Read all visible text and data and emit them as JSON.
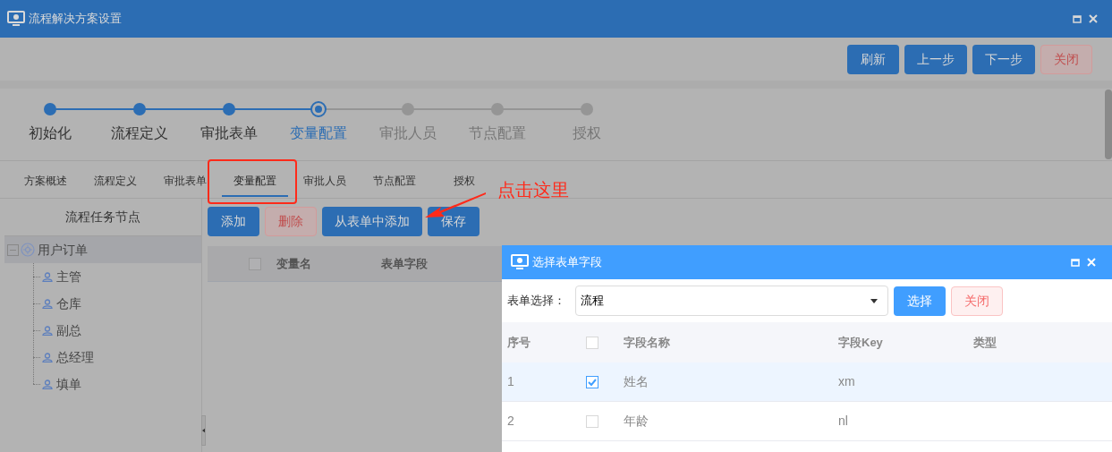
{
  "window": {
    "title": "流程解决方案设置"
  },
  "toolbar": [
    {
      "label": "刷新",
      "kind": "primary"
    },
    {
      "label": "上一步",
      "kind": "primary"
    },
    {
      "label": "下一步",
      "kind": "primary"
    },
    {
      "label": "关闭",
      "kind": "danger"
    }
  ],
  "steps": [
    {
      "label": "初始化",
      "completed": true,
      "current": false
    },
    {
      "label": "流程定义",
      "completed": true,
      "current": false
    },
    {
      "label": "审批表单",
      "completed": true,
      "current": false
    },
    {
      "label": "变量配置",
      "completed": false,
      "current": true
    },
    {
      "label": "审批人员",
      "completed": false,
      "current": false
    },
    {
      "label": "节点配置",
      "completed": false,
      "current": false
    },
    {
      "label": "授权",
      "completed": false,
      "current": false
    }
  ],
  "tabs": [
    {
      "label": "方案概述",
      "selected": false
    },
    {
      "label": "流程定义",
      "selected": false
    },
    {
      "label": "审批表单",
      "selected": false
    },
    {
      "label": "变量配置",
      "selected": true
    },
    {
      "label": "审批人员",
      "selected": false
    },
    {
      "label": "节点配置",
      "selected": false
    },
    {
      "label": "授权",
      "selected": false
    }
  ],
  "annotation": {
    "text": "点击这里"
  },
  "sidebar": {
    "title": "流程任务节点",
    "tree": [
      {
        "label": "用户订单",
        "expanded": true,
        "selected": true,
        "children": [
          {
            "label": "主管"
          },
          {
            "label": "仓库"
          },
          {
            "label": "副总"
          },
          {
            "label": "总经理"
          },
          {
            "label": "填单"
          }
        ]
      }
    ]
  },
  "actions": [
    {
      "label": "添加",
      "kind": "primary"
    },
    {
      "label": "删除",
      "kind": "danger"
    },
    {
      "label": "从表单中添加",
      "kind": "primary"
    },
    {
      "label": "保存",
      "kind": "primary"
    }
  ],
  "table": {
    "all_checked": false,
    "columns": [
      "变量名",
      "表单字段"
    ]
  },
  "dialog": {
    "title": "选择表单字段",
    "form_label": "表单选择：",
    "select_value": "流程",
    "buttons": [
      {
        "label": "选择",
        "kind": "primary"
      },
      {
        "label": "关闭",
        "kind": "danger"
      }
    ],
    "table": {
      "all_checked": false,
      "columns": [
        "序号",
        "字段名称",
        "字段Key",
        "类型"
      ],
      "rows": [
        {
          "index": "1",
          "name": "姓名",
          "key": "xm",
          "checked": true,
          "selected": true
        },
        {
          "index": "2",
          "name": "年龄",
          "key": "nl",
          "checked": false,
          "selected": false
        }
      ]
    }
  }
}
